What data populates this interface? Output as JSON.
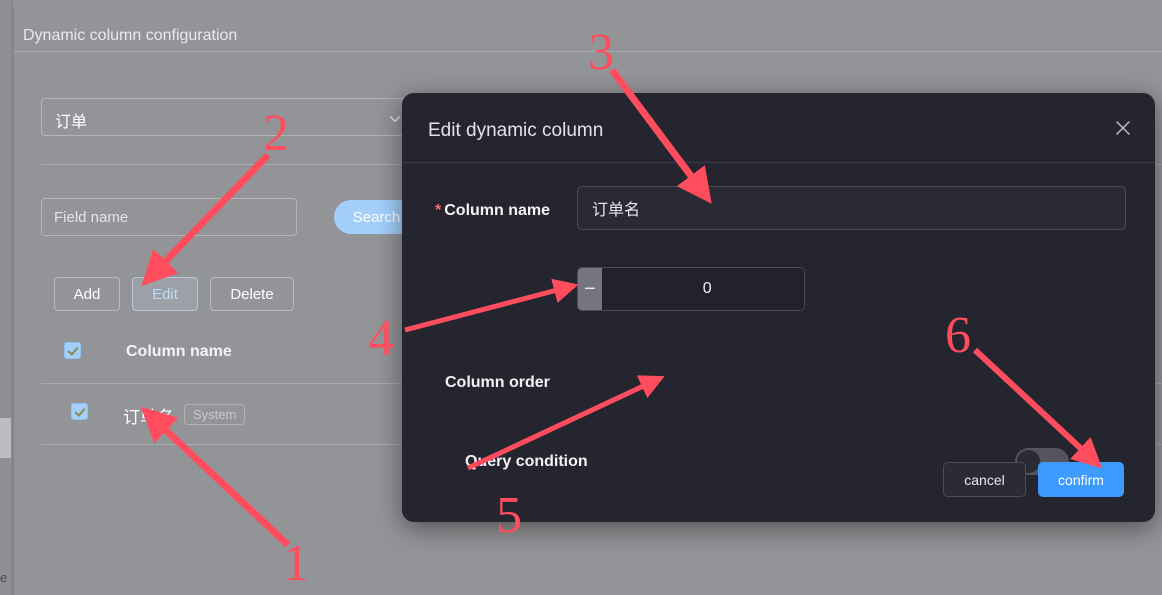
{
  "page": {
    "title": "Dynamic column configuration",
    "background_color": "#939498",
    "rail_glyph": "e"
  },
  "filters": {
    "table_select": {
      "value": "订单",
      "caret_icon": "chevron-down-icon"
    },
    "field_name": {
      "value": "",
      "placeholder": "Field name"
    },
    "search_label": "Search"
  },
  "actions": {
    "add_label": "Add",
    "edit_label": "Edit",
    "delete_label": "Delete",
    "active": "Edit"
  },
  "list": {
    "header": {
      "checkbox_checked": true,
      "label": "Column name"
    },
    "rows": [
      {
        "checkbox_checked": true,
        "name": "订单名",
        "tag": "System"
      }
    ]
  },
  "modal": {
    "title": "Edit dynamic column",
    "close_icon": "close-icon",
    "fields": {
      "column_name": {
        "required_marker": "*",
        "label": "Column name",
        "value": "订单名",
        "placeholder": ""
      },
      "column_order": {
        "label": "Column order",
        "value": "0",
        "decrement_label": "−",
        "increment_label": "+"
      },
      "query_condition": {
        "label": "Query condition",
        "enabled": false
      }
    },
    "cancel_label": "cancel",
    "confirm_label": "confirm"
  },
  "colors": {
    "accent_blue": "#3d9bfd",
    "light_blue": "#a3cffa",
    "modal_bg": "#25252f",
    "annotation_red": "#ff4d5e",
    "required_red": "#f56c6c"
  },
  "annotations": [
    {
      "number": "1"
    },
    {
      "number": "2"
    },
    {
      "number": "3"
    },
    {
      "number": "4"
    },
    {
      "number": "5"
    },
    {
      "number": "6"
    }
  ]
}
